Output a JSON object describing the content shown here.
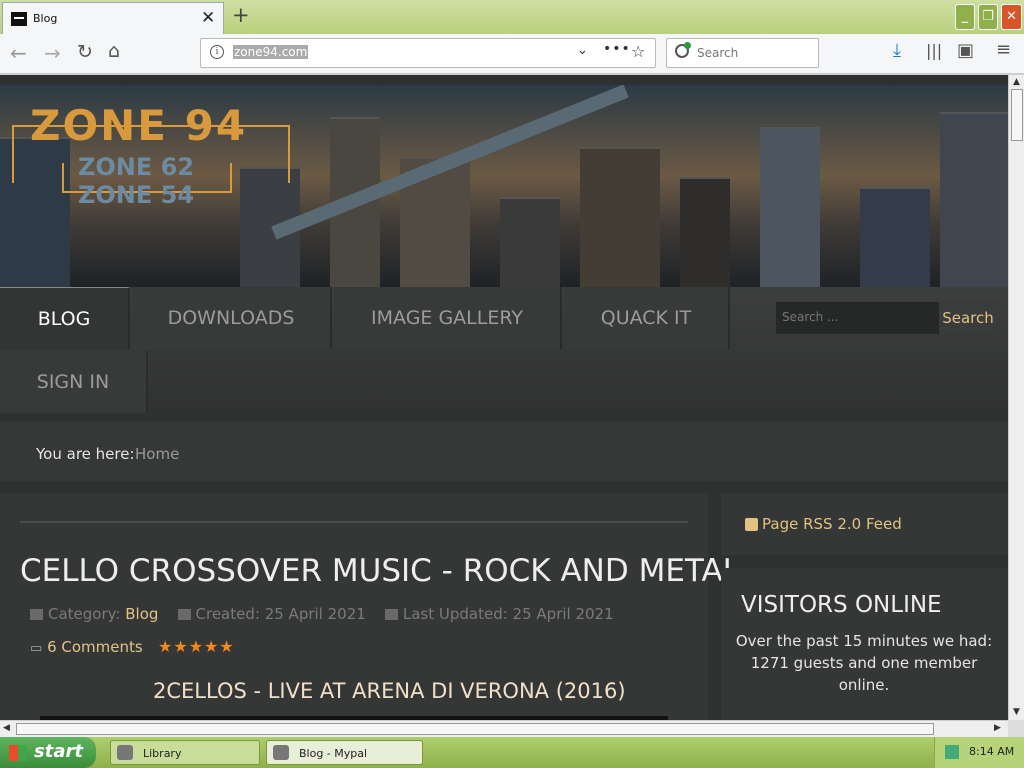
{
  "browser": {
    "tab_title": "Blog",
    "url": "zone94.com",
    "search_placeholder": "Search",
    "new_tab": "+",
    "tab_close": "✕"
  },
  "site": {
    "logo_main": "ZONE 94",
    "logo_sub1": "ZONE 62",
    "logo_sub2": "ZONE 54",
    "menu": [
      "BLOG",
      "DOWNLOADS",
      "IMAGE GALLERY",
      "QUACK IT",
      "SIGN IN"
    ],
    "search_placeholder": "Search ...",
    "search_button": "Search",
    "breadcrumb_label": "You are here:",
    "breadcrumb_home": "Home"
  },
  "article": {
    "title": "CELLO CROSSOVER MUSIC - ROCK AND METAL",
    "category_label": "Category:",
    "category": "Blog",
    "created": "Created: 25 April 2021",
    "updated": "Last Updated: 25 April 2021",
    "comments": "6 Comments",
    "rating": 5,
    "subtitle": "2CELLOS - LIVE AT ARENA DI VERONA (2016)"
  },
  "sidebar": {
    "rss": "Page RSS 2.0 Feed",
    "visitors_title": "VISITORS ONLINE",
    "visitors_text": "Over the past 15 minutes we had: 1271 guests and one member online."
  },
  "taskbar": {
    "start": "start",
    "items": [
      "Library",
      "Blog - Mypal"
    ],
    "clock": "8:14 AM"
  },
  "colors": {
    "accent": "#e2c384",
    "star": "#f08a1c",
    "page_bg": "#2f3030",
    "logo": "#d89a3c"
  }
}
